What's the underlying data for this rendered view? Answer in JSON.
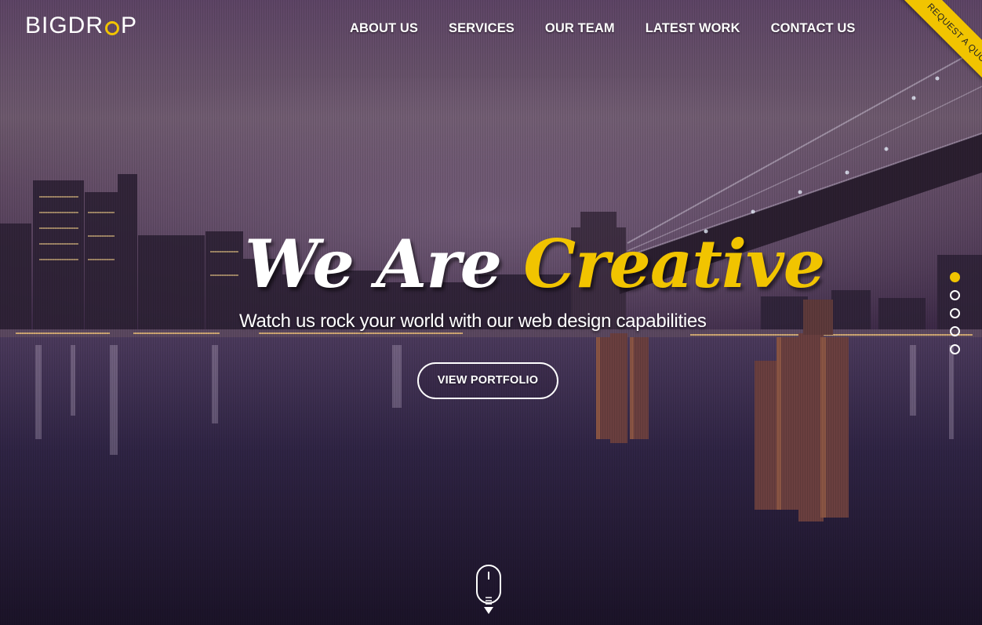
{
  "header": {
    "logo_part1": "BIGDR",
    "logo_part2": "P",
    "nav": [
      "ABOUT US",
      "SERVICES",
      "OUR TEAM",
      "LATEST WORK",
      "CONTACT US"
    ],
    "ribbon_label": "Request a quote"
  },
  "hero": {
    "headline_white": "We Are",
    "headline_yellow": "Creative",
    "tagline": "Watch us rock your world with our web design capabilities",
    "cta_label": "VIEW PORTFOLIO"
  },
  "slider": {
    "count": 5,
    "active_index": 0
  },
  "colors": {
    "accent": "#f1c400",
    "text": "#ffffff"
  },
  "icons": {
    "scroll": "mouse-scroll-icon"
  }
}
